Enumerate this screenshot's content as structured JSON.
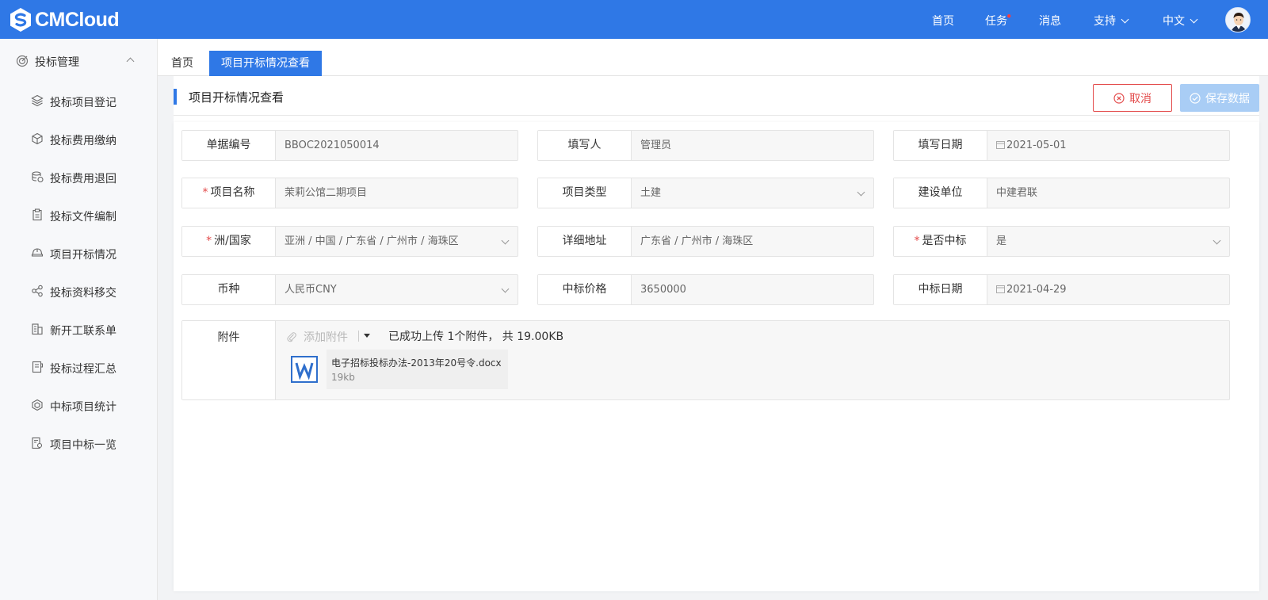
{
  "app": {
    "logo_text": "CMCloud",
    "brand_color": "#2f78e6"
  },
  "topnav": {
    "items": [
      {
        "label": "首页"
      },
      {
        "label": "任务",
        "dot": "•"
      },
      {
        "label": "消息"
      },
      {
        "label": "支持"
      },
      {
        "label": "中文"
      }
    ]
  },
  "sidebar": {
    "group": {
      "label": "投标管理",
      "icon": "target-icon",
      "expanded": true
    },
    "items": [
      {
        "label": "投标项目登记",
        "icon": "layers-icon"
      },
      {
        "label": "投标费用缴纳",
        "icon": "cube-icon"
      },
      {
        "label": "投标费用退回",
        "icon": "coins-return-icon"
      },
      {
        "label": "投标文件编制",
        "icon": "clipboard-icon"
      },
      {
        "label": "项目开标情况",
        "icon": "helmet-icon"
      },
      {
        "label": "投标资料移交",
        "icon": "share-icon"
      },
      {
        "label": "新开工联系单",
        "icon": "building-icon"
      },
      {
        "label": "投标过程汇总",
        "icon": "notebook-icon"
      },
      {
        "label": "中标项目统计",
        "icon": "hexagon-icon"
      },
      {
        "label": "项目中标一览",
        "icon": "document-search-icon"
      }
    ]
  },
  "tabs": [
    {
      "label": "首页",
      "active": false
    },
    {
      "label": "项目开标情况查看",
      "active": true
    }
  ],
  "page": {
    "title": "项目开标情况查看",
    "cancel_label": "取消",
    "save_label": "保存数据"
  },
  "form": {
    "doc_no": {
      "label": "单据编号",
      "value": "BBOC2021050014"
    },
    "filler": {
      "label": "填写人",
      "value": "管理员"
    },
    "fill_date": {
      "label": "填写日期",
      "value": "2021-05-01"
    },
    "project_name": {
      "label": "项目名称",
      "value": "茉莉公馆二期项目",
      "required": "*"
    },
    "project_type": {
      "label": "项目类型",
      "value": "土建"
    },
    "builder": {
      "label": "建设单位",
      "value": "中建君联"
    },
    "region": {
      "label": "洲/国家",
      "value": "亚洲 / 中国 / 广东省 / 广州市 / 海珠区",
      "required": "*"
    },
    "address": {
      "label": "详细地址",
      "value": "广东省 / 广州市 / 海珠区"
    },
    "won": {
      "label": "是否中标",
      "value": "是",
      "required": "*"
    },
    "currency": {
      "label": "币种",
      "value": "人民币CNY"
    },
    "bid_price": {
      "label": "中标价格",
      "value": "3650000"
    },
    "bid_date": {
      "label": "中标日期",
      "value": "2021-04-29"
    }
  },
  "attachment": {
    "label": "附件",
    "add_label": "添加附件",
    "status": "已成功上传 1个附件， 共 19.00KB",
    "files": [
      {
        "name": "电子招标投标办法-2013年20号令.docx",
        "size": "19kb",
        "icon": "word-icon"
      }
    ]
  }
}
